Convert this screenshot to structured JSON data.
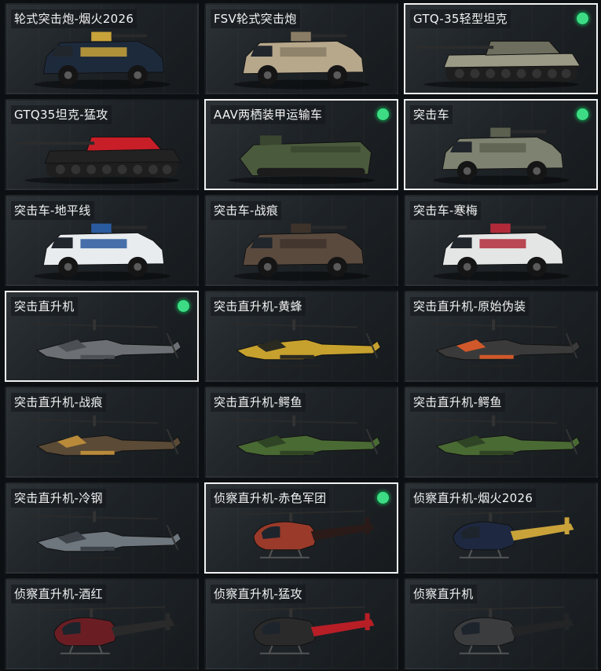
{
  "items": [
    {
      "name": "轮式突击炮-烟火2026",
      "kind": "wheeled",
      "colors": [
        "#1d2a3c",
        "#c9a33a"
      ],
      "selected": false,
      "equipped": false
    },
    {
      "name": "FSV轮式突击炮",
      "kind": "wheeled",
      "colors": [
        "#b7a88c",
        "#8a7d66"
      ],
      "selected": false,
      "equipped": false
    },
    {
      "name": "GTQ-35轻型坦克",
      "kind": "tank",
      "colors": [
        "#9a9a86",
        "#6e6e5e"
      ],
      "selected": true,
      "equipped": true
    },
    {
      "name": "GTQ35坦克-猛攻",
      "kind": "tank",
      "colors": [
        "#222222",
        "#c81e28"
      ],
      "selected": false,
      "equipped": false
    },
    {
      "name": "AAV两栖装甲运输车",
      "kind": "amphib",
      "colors": [
        "#4a5a3c",
        "#3a4630"
      ],
      "selected": true,
      "equipped": true
    },
    {
      "name": "突击车",
      "kind": "apc",
      "colors": [
        "#7e8270",
        "#5c604f"
      ],
      "selected": true,
      "equipped": true
    },
    {
      "name": "突击车-地平线",
      "kind": "apc",
      "colors": [
        "#e8ecef",
        "#2a5b9e"
      ],
      "selected": false,
      "equipped": false
    },
    {
      "name": "突击车-战痕",
      "kind": "apc",
      "colors": [
        "#5a4a3e",
        "#3e332b"
      ],
      "selected": false,
      "equipped": false
    },
    {
      "name": "突击车-寒梅",
      "kind": "apc",
      "colors": [
        "#e4e6e6",
        "#b22a3a"
      ],
      "selected": false,
      "equipped": false
    },
    {
      "name": "突击直升机",
      "kind": "attack",
      "colors": [
        "#6c7074",
        "#4c5054"
      ],
      "selected": true,
      "equipped": true
    },
    {
      "name": "突击直升机-黄蜂",
      "kind": "attack",
      "colors": [
        "#c6a12e",
        "#2a2a20"
      ],
      "selected": false,
      "equipped": false
    },
    {
      "name": "突击直升机-原始伪装",
      "kind": "attack",
      "colors": [
        "#3a3a3a",
        "#d0582a"
      ],
      "selected": false,
      "equipped": false
    },
    {
      "name": "突击直升机-战痕",
      "kind": "attack",
      "colors": [
        "#5a4a36",
        "#b88a3a"
      ],
      "selected": false,
      "equipped": false
    },
    {
      "name": "突击直升机-鳄鱼",
      "kind": "attack",
      "colors": [
        "#4a6a34",
        "#2e4424"
      ],
      "selected": false,
      "equipped": false
    },
    {
      "name": "突击直升机-鳄鱼",
      "kind": "attack",
      "colors": [
        "#4a6a34",
        "#2e4424"
      ],
      "selected": false,
      "equipped": false
    },
    {
      "name": "突击直升机-冷钢",
      "kind": "attack",
      "colors": [
        "#6e767e",
        "#3c4248"
      ],
      "selected": false,
      "equipped": false
    },
    {
      "name": "侦察直升机-赤色军团",
      "kind": "scout",
      "colors": [
        "#9a3a2a",
        "#2a1a18"
      ],
      "selected": true,
      "equipped": true
    },
    {
      "name": "侦察直升机-烟火2026",
      "kind": "scout",
      "colors": [
        "#1e2840",
        "#c9a33a"
      ],
      "selected": false,
      "equipped": false
    },
    {
      "name": "侦察直升机-酒红",
      "kind": "scout",
      "colors": [
        "#6a1e24",
        "#2a2a2a"
      ],
      "selected": false,
      "equipped": false
    },
    {
      "name": "侦察直升机-猛攻",
      "kind": "scout",
      "colors": [
        "#2a2a2a",
        "#b81e26"
      ],
      "selected": false,
      "equipped": false
    },
    {
      "name": "侦察直升机",
      "kind": "scout",
      "colors": [
        "#3a3c3e",
        "#222426"
      ],
      "selected": false,
      "equipped": false
    }
  ]
}
